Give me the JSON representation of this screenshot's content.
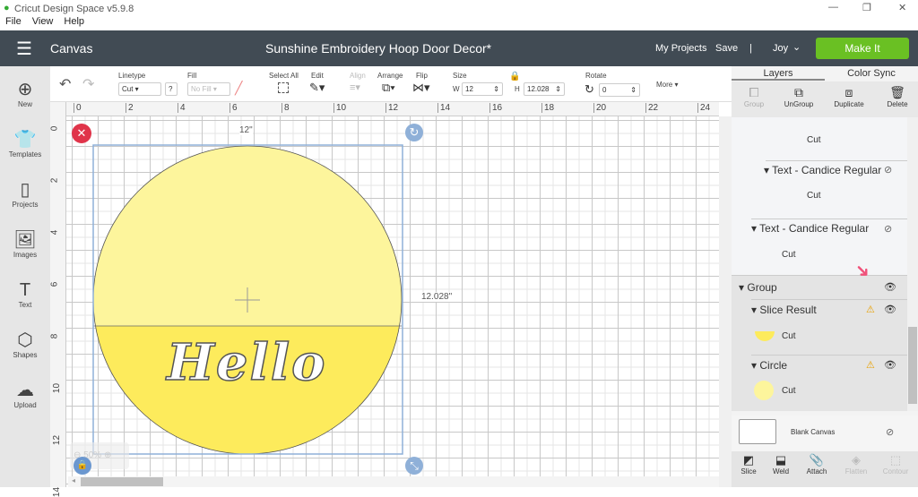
{
  "window": {
    "title": "Cricut Design Space  v5.9.8",
    "controls": [
      "—",
      "❐",
      "✕"
    ]
  },
  "menu": [
    "File",
    "View",
    "Help"
  ],
  "header": {
    "section": "Canvas",
    "project_title": "Sunshine Embroidery Hoop Door Decor*",
    "my_projects": "My Projects",
    "save": "Save",
    "separator": "|",
    "user": "Joy",
    "make_it": "Make It",
    "make_it_color": "#6ac023"
  },
  "toolbar": {
    "linetype_label": "Linetype",
    "linetype_value": "Cut",
    "help": "?",
    "fill_label": "Fill",
    "fill_value": "No Fill",
    "select_all": "Select All",
    "edit": "Edit",
    "align": "Align",
    "arrange": "Arrange",
    "flip": "Flip",
    "size_label": "Size",
    "w_label": "W",
    "w_value": "12",
    "h_label": "H",
    "h_value": "12.028",
    "rotate_label": "Rotate",
    "rotate_value": "0",
    "more": "More"
  },
  "leftbar": [
    {
      "label": "New",
      "icon": "plus-circle-icon"
    },
    {
      "label": "Templates",
      "icon": "shirt-icon"
    },
    {
      "label": "Projects",
      "icon": "notebook-icon"
    },
    {
      "label": "Images",
      "icon": "image-icon"
    },
    {
      "label": "Text",
      "icon": "text-icon"
    },
    {
      "label": "Shapes",
      "icon": "shapes-icon"
    },
    {
      "label": "Upload",
      "icon": "cloud-upload-icon"
    }
  ],
  "ruler": {
    "h": [
      "0",
      "2",
      "4",
      "6",
      "8",
      "10",
      "12",
      "14",
      "16",
      "18",
      "20",
      "22",
      "24"
    ],
    "v": [
      "0",
      "2",
      "4",
      "6",
      "8",
      "10",
      "12",
      "14"
    ]
  },
  "canvas": {
    "width_label": "12\"",
    "height_label": "12.028\"",
    "text": "Hello",
    "zoom": "50%",
    "top_color": "#fdf59c",
    "bottom_color": "#fdeb5c"
  },
  "panel": {
    "tabs": [
      "Layers",
      "Color Sync"
    ],
    "actions": [
      "Group",
      "UnGroup",
      "Duplicate",
      "Delete"
    ],
    "layers": [
      {
        "name": "",
        "sub": "Cut"
      },
      {
        "name": "Text - Candice Regular",
        "sub": "Cut",
        "hidden": true
      },
      {
        "name": "Text - Candice Regular",
        "sub": "Cut",
        "hidden": true
      },
      {
        "name": "Group",
        "visible": true
      },
      {
        "name": "Slice Result",
        "sub": "Cut",
        "warning": true
      },
      {
        "name": "Circle",
        "sub": "Cut",
        "warning": true
      }
    ],
    "blank_canvas": "Blank Canvas",
    "bottom_actions": [
      "Slice",
      "Weld",
      "Attach",
      "Flatten",
      "Contour"
    ]
  }
}
